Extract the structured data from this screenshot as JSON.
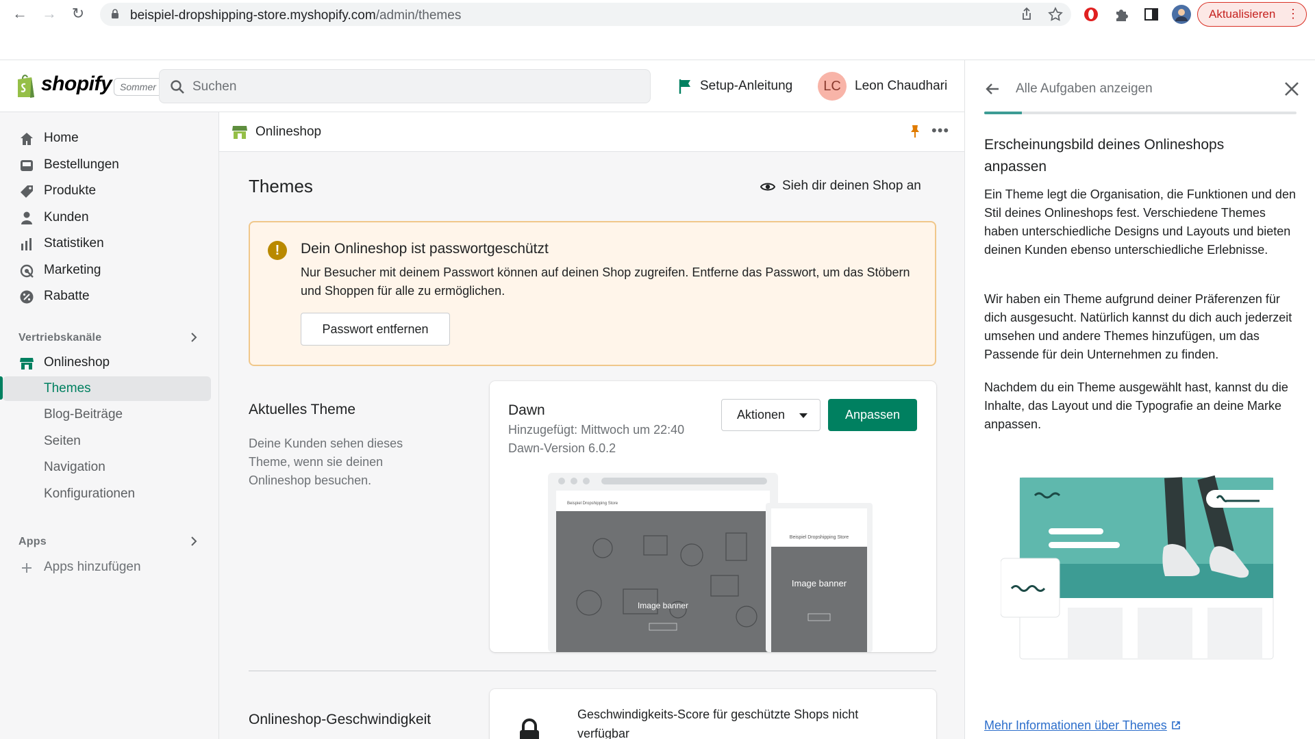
{
  "browser": {
    "url_host": "beispiel-dropshipping-store.myshopify.com",
    "url_path": "/admin/themes",
    "update_label": "Aktualisieren"
  },
  "topbar": {
    "brand": "shopify",
    "store_badge": "Sommer",
    "search_placeholder": "Suchen",
    "setup_label": "Setup-Anleitung",
    "user_initials": "LC",
    "user_name": "Leon Chaudhari"
  },
  "sidebar": {
    "items": [
      {
        "label": "Home",
        "icon": "home-icon"
      },
      {
        "label": "Bestellungen",
        "icon": "orders-icon"
      },
      {
        "label": "Produkte",
        "icon": "tag-icon"
      },
      {
        "label": "Kunden",
        "icon": "person-icon"
      },
      {
        "label": "Statistiken",
        "icon": "bar-chart-icon"
      },
      {
        "label": "Marketing",
        "icon": "target-icon"
      },
      {
        "label": "Rabatte",
        "icon": "discount-icon"
      }
    ],
    "sales_channels_heading": "Vertriebskanäle",
    "online_store_label": "Onlineshop",
    "sub_items": [
      "Themes",
      "Blog-Beiträge",
      "Seiten",
      "Navigation",
      "Konfigurationen"
    ],
    "apps_heading": "Apps",
    "add_apps_label": "Apps hinzufügen"
  },
  "main": {
    "header_title": "Onlineshop",
    "page_title": "Themes",
    "view_shop_label": "Sieh dir deinen Shop an",
    "banner": {
      "title": "Dein Onlineshop ist passwortgeschützt",
      "text": "Nur Besucher mit deinem Passwort können auf deinen Shop zugreifen. Entferne das Passwort, um das Stöbern und Shoppen für alle zu ermöglichen.",
      "button_label": "Passwort entfernen"
    },
    "current_theme": {
      "section_title": "Aktuelles Theme",
      "section_desc": "Deine Kunden sehen dieses Theme, wenn sie deinen Onlineshop besuchen.",
      "name": "Dawn",
      "added": "Hinzugefügt: Mittwoch um 22:40",
      "version": "Dawn-Version 6.0.2",
      "actions_label": "Aktionen",
      "customize_label": "Anpassen",
      "preview_store_name": "Beispiel Dropshipping Store",
      "preview_banner_label": "Image banner"
    },
    "speed": {
      "section_title": "Onlineshop-Geschwindigkeit",
      "text": "Geschwindigkeits-Score für geschützte Shops nicht verfügbar"
    }
  },
  "panel": {
    "nav_label": "Alle Aufgaben anzeigen",
    "progress_fraction": 0.12,
    "title": "Erscheinungsbild deines Onlineshops anpassen",
    "paragraphs": [
      "Ein Theme legt die Organisation, die Funktionen und den Stil deines Onlineshops fest. Verschiedene Themes haben unterschiedliche Designs und Layouts und bieten deinen Kunden ebenso unterschiedliche Erlebnisse.",
      "Wir haben ein Theme aufgrund deiner Präferenzen für dich ausgesucht. Natürlich kannst du dich auch jederzeit umsehen und andere Themes hinzufügen, um das Passende für dein Unternehmen zu finden.",
      "Nachdem du ein Theme ausgewählt hast, kannst du die Inhalte, das Layout und die Typografie an deine Marke anpassen."
    ],
    "more_link": "Mehr Informationen über Themes"
  },
  "colors": {
    "accent_green": "#008060",
    "warning_border": "#f0c78a",
    "warning_bg": "#fff5ea",
    "link_blue": "#2c6ecb",
    "illustration_teal": "#5fb8ad"
  }
}
